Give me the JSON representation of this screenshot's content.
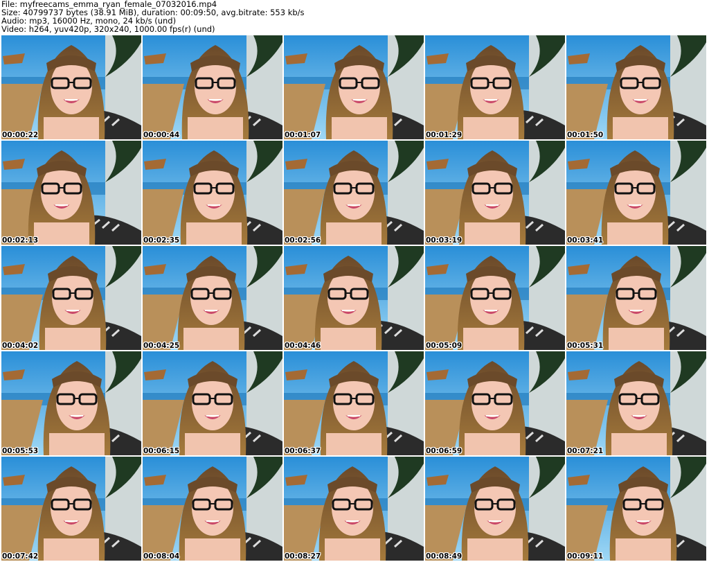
{
  "header": {
    "file": "File: myfreecams_emma_ryan_female_07032016.mp4",
    "size": "Size: 40799737 bytes (38.91 MiB), duration: 00:09:50, avg.bitrate: 553 kb/s",
    "audio": "Audio: mp3, 16000 Hz, mono, 24 kb/s (und)",
    "video": "Video: h264, yuv420p, 320x240, 1000.00 fps(r) (und)"
  },
  "thumbnails": [
    {
      "timestamp": "00:00:22"
    },
    {
      "timestamp": "00:00:44"
    },
    {
      "timestamp": "00:01:07"
    },
    {
      "timestamp": "00:01:29"
    },
    {
      "timestamp": "00:01:50"
    },
    {
      "timestamp": "00:02:13"
    },
    {
      "timestamp": "00:02:35"
    },
    {
      "timestamp": "00:02:56"
    },
    {
      "timestamp": "00:03:19"
    },
    {
      "timestamp": "00:03:41"
    },
    {
      "timestamp": "00:04:02"
    },
    {
      "timestamp": "00:04:25"
    },
    {
      "timestamp": "00:04:46"
    },
    {
      "timestamp": "00:05:09"
    },
    {
      "timestamp": "00:05:31"
    },
    {
      "timestamp": "00:05:53"
    },
    {
      "timestamp": "00:06:15"
    },
    {
      "timestamp": "00:06:37"
    },
    {
      "timestamp": "00:06:59"
    },
    {
      "timestamp": "00:07:21"
    },
    {
      "timestamp": "00:07:42"
    },
    {
      "timestamp": "00:08:04"
    },
    {
      "timestamp": "00:08:27"
    },
    {
      "timestamp": "00:08:49"
    },
    {
      "timestamp": "00:09:11"
    }
  ]
}
